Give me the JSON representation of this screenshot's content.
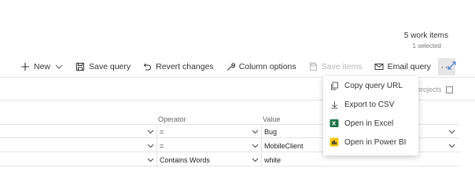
{
  "summary": {
    "count": "5 work items",
    "selected": "1 selected"
  },
  "toolbar": {
    "new": "New",
    "save_query": "Save query",
    "revert": "Revert changes",
    "column_options": "Column options",
    "save_items": "Save items",
    "email_query": "Email query",
    "more": "···"
  },
  "filter_bar": {
    "projects": "projects"
  },
  "clauses": {
    "headers": {
      "operator": "Operator",
      "value": "Value"
    },
    "rows": [
      {
        "operator": "=",
        "value": "Bug"
      },
      {
        "operator": "=",
        "value": "MobileClient"
      },
      {
        "operator": "Contains Words",
        "value": "white"
      }
    ]
  },
  "menu": {
    "items": [
      {
        "label": "Copy query URL",
        "icon": "copy-icon"
      },
      {
        "label": "Export to CSV",
        "icon": "download-icon"
      },
      {
        "label": "Open in Excel",
        "icon": "excel-icon"
      },
      {
        "label": "Open in Power BI",
        "icon": "powerbi-icon"
      }
    ]
  },
  "colors": {
    "excel": "#1e7145",
    "powerbi": "#f2c811",
    "more_bg": "#e6e6e6",
    "disabled": "#b8b8b8"
  }
}
